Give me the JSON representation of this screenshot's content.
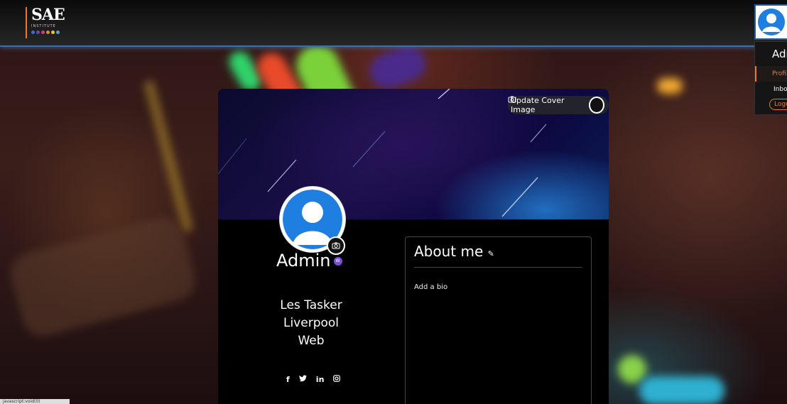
{
  "header": {
    "logo_text": "SAE",
    "logo_sub": "INSTITUTE",
    "logo_dots": [
      "#3b6fd8",
      "#6f3fc9",
      "#d83b7a",
      "#e8852a",
      "#e8c62a",
      "#3bb0d8"
    ]
  },
  "user_menu": {
    "title": "Admin",
    "items": [
      {
        "label": "Profile",
        "active": true
      },
      {
        "label": "Inbox",
        "active": false
      }
    ],
    "logout_label": "Logout"
  },
  "cover": {
    "update_label": "Update Cover Image"
  },
  "profile": {
    "name": "Admin",
    "badge": "W",
    "full_name": "Les Tasker",
    "location": "Liverpool",
    "department": "Web",
    "socials": [
      "facebook-icon",
      "twitter-icon",
      "linkedin-icon",
      "instagram-icon"
    ]
  },
  "about": {
    "title": "About me",
    "bio_placeholder": "Add a bio"
  },
  "statusbar": {
    "text": "javascript:void(0)"
  },
  "colors": {
    "accent": "#e87b2a",
    "header_border": "#3c6ea8",
    "avatar_blue": "#1f7fe0",
    "badge": "#7a4fd6"
  }
}
